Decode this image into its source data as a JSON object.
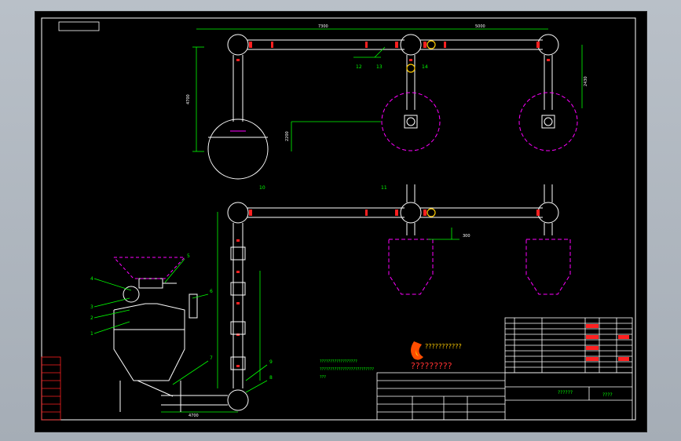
{
  "drawing": {
    "dims": {
      "top_span_1": "7300",
      "top_span_2": "5000",
      "left_vertical": "4700",
      "right_vertical": "2430",
      "offset_small": "2200",
      "lower_offset": "300",
      "bottom_width": "4700"
    },
    "part_numbers": [
      "1",
      "2",
      "3",
      "4",
      "5",
      "6",
      "7",
      "8",
      "9",
      "10",
      "11",
      "12",
      "13",
      "14"
    ],
    "notes": [
      "??????????????????",
      "??????????????????????????",
      "???"
    ],
    "logo_text_1": "???????????",
    "logo_text_2": "?????????",
    "title_block": {
      "company": "??????",
      "drawing_name": "????"
    }
  }
}
